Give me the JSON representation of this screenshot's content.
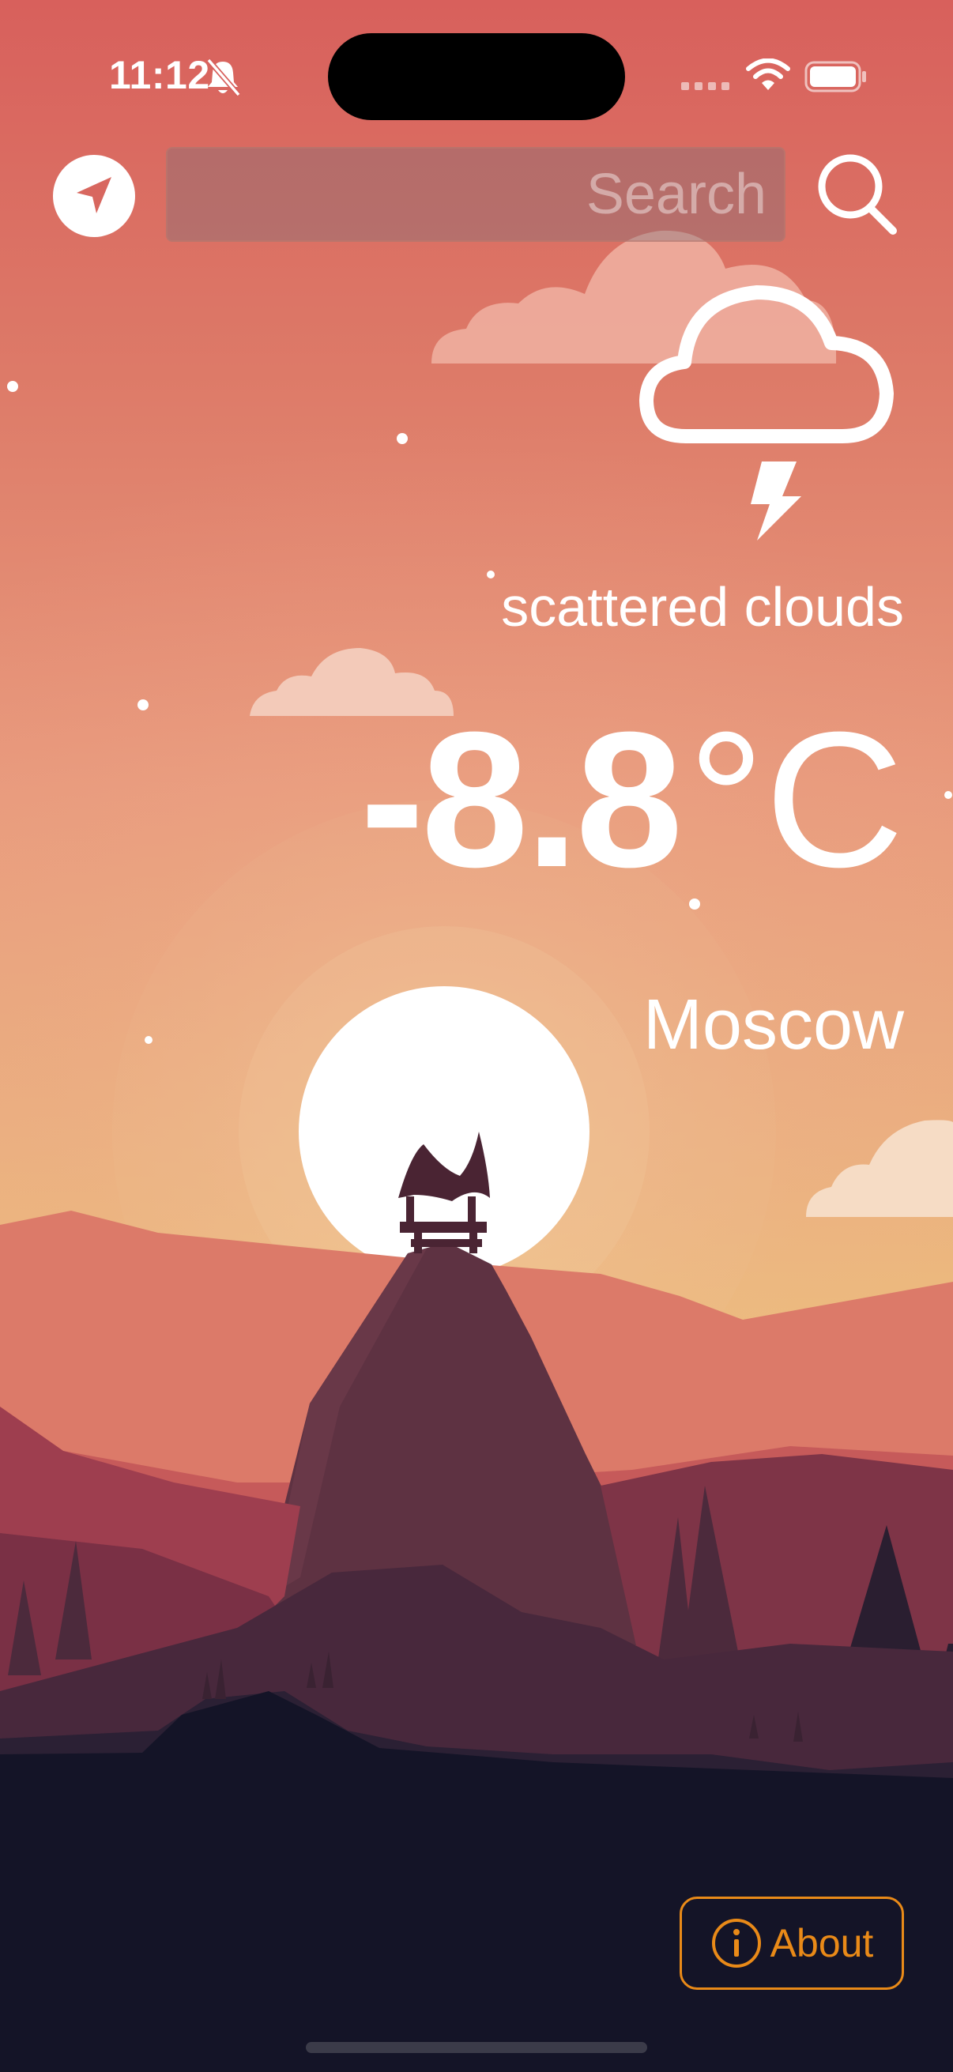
{
  "status_bar": {
    "time": "11:12",
    "icons": [
      "bell-slash-icon",
      "cellular-signal-icon",
      "wifi-icon",
      "battery-icon"
    ]
  },
  "toolbar": {
    "location_icon": "location-arrow-icon",
    "search_placeholder": "Search",
    "search_value": "",
    "search_icon": "magnifying-glass-icon"
  },
  "weather": {
    "condition_icon": "cloud-bolt-icon",
    "condition": "scattered clouds",
    "temperature": "-8.8",
    "unit": "°C",
    "city": "Moscow"
  },
  "about": {
    "label": "About",
    "icon": "info-circle-icon"
  },
  "colors": {
    "sky_top": "#d8605c",
    "sky_mid": "#e99a79",
    "sky_horizon": "#ebc07a",
    "ground": "#141427",
    "accent": "#e98a18",
    "text": "#ffffff"
  }
}
